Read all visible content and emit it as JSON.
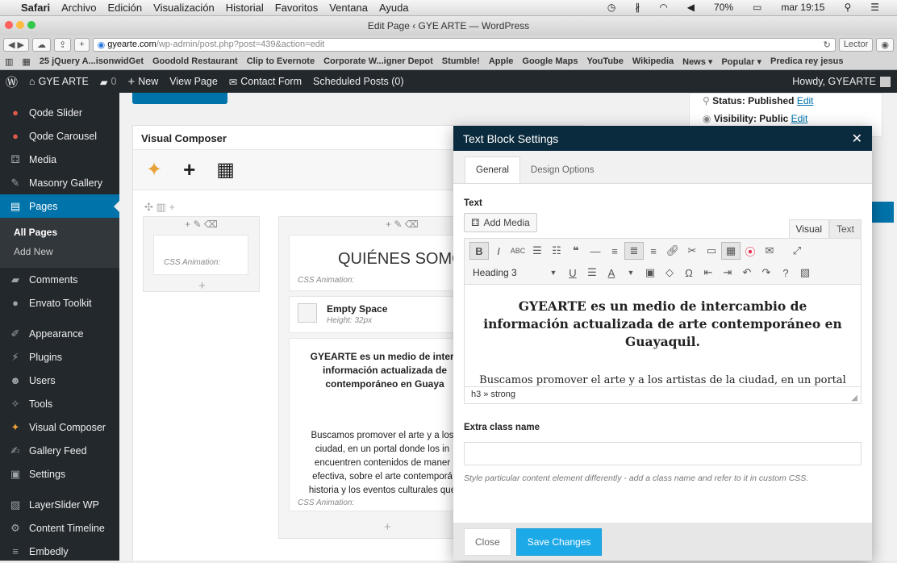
{
  "mac_menu": {
    "apple": "",
    "items": [
      "Safari",
      "Archivo",
      "Edición",
      "Visualización",
      "Historial",
      "Favoritos",
      "Ventana",
      "Ayuda"
    ],
    "battery": "70%",
    "clock": "mar 19:15"
  },
  "window": {
    "title": "Edit Page ‹ GYE ARTE — WordPress"
  },
  "toolbar": {
    "url_host": "gyearte.com",
    "url_path": "/wp-admin/post.php?post=439&action=edit",
    "reader": "Lector"
  },
  "bookmarks": [
    "25 jQuery A...isonwidGet",
    "Goodold Restaurant",
    "Clip to Evernote",
    "Corporate W...igner Depot",
    "Stumble!",
    "Apple",
    "Google Maps",
    "YouTube",
    "Wikipedia",
    "News ▾",
    "Popular ▾",
    "Predica rey jesus"
  ],
  "adminbar": {
    "site": "GYE ARTE",
    "comments": "0",
    "new": "New",
    "view": "View Page",
    "contact": "Contact Form",
    "scheduled": "Scheduled Posts (0)",
    "howdy": "Howdy, GYEARTE"
  },
  "sidebar": {
    "items_top": [
      {
        "label": "Qode Slider",
        "icon": "qode-icon"
      },
      {
        "label": "Qode Carousel",
        "icon": "qode-icon"
      },
      {
        "label": "Media",
        "icon": "media-icon"
      },
      {
        "label": "Masonry Gallery",
        "icon": "pin-icon"
      },
      {
        "label": "Pages",
        "icon": "pages-icon"
      }
    ],
    "sub": [
      "All Pages",
      "Add New"
    ],
    "items_bottom": [
      {
        "label": "Comments",
        "icon": "comments-icon"
      },
      {
        "label": "Envato Toolkit",
        "icon": "envato-icon"
      },
      {
        "label": "Appearance",
        "icon": "brush-icon"
      },
      {
        "label": "Plugins",
        "icon": "plugin-icon"
      },
      {
        "label": "Users",
        "icon": "users-icon"
      },
      {
        "label": "Tools",
        "icon": "wrench-icon"
      },
      {
        "label": "Visual Composer",
        "icon": "vc-icon"
      },
      {
        "label": "Gallery Feed",
        "icon": "feed-icon"
      },
      {
        "label": "Settings",
        "icon": "settings-icon"
      },
      {
        "label": "LayerSlider WP",
        "icon": "layers-icon"
      },
      {
        "label": "Content Timeline",
        "icon": "gear-icon"
      },
      {
        "label": "Embedly",
        "icon": "embed-icon"
      }
    ]
  },
  "publish": {
    "status": "Status: Published",
    "visibility": "Visibility: Public",
    "edit": "Edit"
  },
  "vc": {
    "title": "Visual Composer",
    "css_animation": "CSS Animation:",
    "heading_preview": "QUIÉNES SOMO",
    "empty_space": "Empty Space",
    "empty_height": "Height: 32px",
    "text_bold": "GYEARTE es un medio de interc información actualizada de contemporáneo en Guaya",
    "text_body": "Buscamos promover el arte y a los ciudad, en un portal donde los in encuentren contenidos de maner efectiva, sobre el arte contemporá historia y los eventos culturales que"
  },
  "dialog": {
    "title": "Text Block Settings",
    "tabs": [
      "General",
      "Design Options"
    ],
    "text_label": "Text",
    "add_media": "Add Media",
    "editor_tabs": [
      "Visual",
      "Text"
    ],
    "format": "Heading 3",
    "heading": "GYEARTE es un medio de intercambio de información actualizada de arte contemporáneo en Guayaquil.",
    "paragraph": "Buscamos promover el arte y a los artistas de la ciudad, en un portal donde los interesados encuentren contenidos de manera rápida y efectiva, sobre el arte contemporáneo local, su historia y los eventos culturales que se realizan.",
    "path": "h3 » strong",
    "extra_label": "Extra class name",
    "extra_value": "",
    "help": "Style particular content element differently - add a class name and refer to it in custom CSS.",
    "close": "Close",
    "save": "Save Changes"
  },
  "colors": {
    "accent": "#0073aa",
    "dialog_head": "#0a2a3d",
    "save": "#1ca9e8"
  }
}
